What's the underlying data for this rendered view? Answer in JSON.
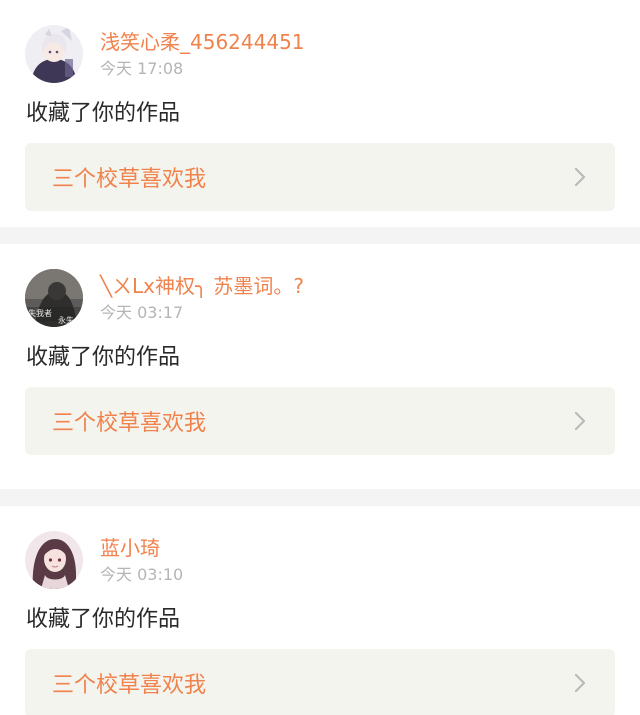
{
  "theme": {
    "accent": "#f0824c",
    "muted": "#b5b5b5",
    "text": "#2a2a2a",
    "card_bg": "#f4f4ef",
    "separator": "#f4f4f4"
  },
  "notifications": [
    {
      "user_name": "浅笑心柔_456244451",
      "time": "今天 17:08",
      "action": "收藏了你的作品",
      "work_title": "三个校草喜欢我",
      "avatar_icon": "anime-girl-avatar-icon"
    },
    {
      "user_name": "╲ㄨLx神权╮ 苏墨词。?",
      "time": "今天 03:17",
      "action": "收藏了你的作品",
      "work_title": "三个校草喜欢我",
      "avatar_icon": "dark-photo-avatar-icon",
      "avatar_text_left": "失我者",
      "avatar_text_right": "永失"
    },
    {
      "user_name": "蓝小琦",
      "time": "今天 03:10",
      "action": "收藏了你的作品",
      "work_title": "三个校草喜欢我",
      "avatar_icon": "anime-girl-long-hair-avatar-icon"
    }
  ]
}
